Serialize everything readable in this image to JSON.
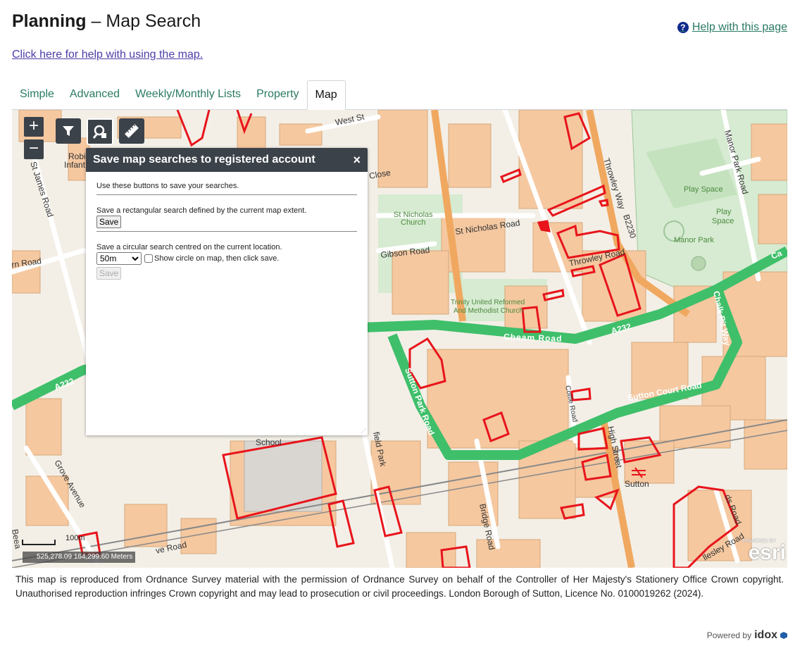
{
  "header": {
    "title_bold": "Planning",
    "title_rest": "– Map Search",
    "help_label": "Help with this page",
    "map_help_link": "Click here for help with using the map."
  },
  "tabs": [
    {
      "label": "Simple"
    },
    {
      "label": "Advanced"
    },
    {
      "label": "Weekly/Monthly Lists"
    },
    {
      "label": "Property"
    },
    {
      "label": "Map"
    }
  ],
  "active_tab": "Map",
  "map": {
    "zoom_in": "+",
    "zoom_out": "−",
    "coordinates": "525,278.09 164,299.60 Meters",
    "scale_label": "100m",
    "attribution": "esri",
    "attribution_small": "POWERED BY",
    "labels": {
      "west_st": "West St",
      "close": "Close",
      "st_james_road": "St James Road",
      "robi": "Robi",
      "infant": "Infant",
      "rn_road": "rn Road",
      "st_nicholas_church_1": "St Nicholas",
      "st_nicholas_church_2": "Church",
      "st_nicholas_road": "St Nicholas Road",
      "gibson_road": "Gibson Road",
      "throwley_way": "Throwley Way",
      "b2230": "B2230",
      "throwley_road": "Throwley Road",
      "manor_park_road": "Manor Park Road",
      "play_space_1": "Play Space",
      "play_space_2a": "Play",
      "play_space_2b": "Space",
      "manor_park": "Manor Park",
      "trinity_1": "Trinity United Reformed",
      "trinity_2": "And Methodist Church",
      "cheam_road": "Cheam Road",
      "a232": "A232",
      "a232_left": "A232",
      "ca": "Ca",
      "chalk_pit_way": "Chalk Pit Way",
      "sutton_park_road": "Sutton Park Road",
      "sutton_court_road": "Sutton Court Road",
      "cottle_road": "Cottle Road",
      "high_street": "High Street",
      "sutton": "Sutton",
      "school": "School",
      "field_park": "field Park",
      "grove_avenue": "Grove Avenue",
      "bridge_road": "Bridge Road",
      "ve_road": "ve Road",
      "llesley_road": "llesley Road",
      "ds_road": "ds Road",
      "beea": "Beea"
    }
  },
  "dialog": {
    "title": "Save map searches to registered account",
    "close": "×",
    "intro": "Use these buttons to save your searches.",
    "rect_desc": "Save a rectangular search defined by the current map extent.",
    "save_label": "Save",
    "circle_desc": "Save a circular search centred on the current location.",
    "radius_value": "50m",
    "show_circle_label": "Show circle on map, then click save.",
    "save_disabled_label": "Save"
  },
  "disclaimer": "This map is reproduced from Ordnance Survey material with the permission of Ordnance Survey on behalf of the Controller of Her Majesty's Stationery Office Crown copyright. Unauthorised reproduction infringes Crown copyright and may lead to prosecution or civil proceedings. London Borough of Sutton, Licence No. 0100019262 (2024).",
  "footer": {
    "powered_by": "Powered by",
    "brand": "idox"
  },
  "colors": {
    "link_green": "#2a7a63",
    "link_purple": "#4b3ea8",
    "a_road": "#3fbf6a",
    "b_road": "#f0a860",
    "building": "#f5c8a0",
    "park": "#d6ebd1",
    "site_outline": "#e8141b",
    "toolbar": "#3b424a"
  }
}
